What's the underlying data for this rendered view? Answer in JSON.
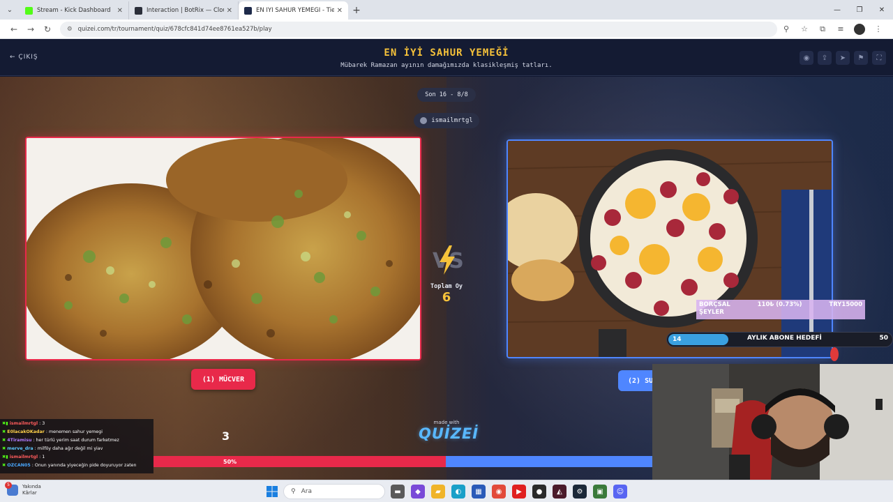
{
  "browser": {
    "tabs": [
      {
        "title": "Stream - Kick Dashboard",
        "color": "#53fc18"
      },
      {
        "title": "Interaction | BotRix — Cloud Str",
        "color": "#2b2f3a"
      },
      {
        "title": "EN İYİ SAHUR YEMEĞİ - Tier Li",
        "color": "#1e2a4a"
      }
    ],
    "url": "quizei.com/tr/tournament/quiz/678cfc841d74ee8761ea527b/play"
  },
  "app": {
    "exit_label": "ÇIKIŞ",
    "title": "EN İYİ SAHUR YEMEĞİ",
    "subtitle": "Mübarek Ramazan ayının damağımızda klasikleşmiş tatları.",
    "round": "Son 16 - 8/8",
    "username": "ismailmrtgl",
    "total_votes_label": "Toplam Oy",
    "total_votes": "6",
    "left_choice": {
      "key": "(1)",
      "name": "MÜCVER",
      "score": "3"
    },
    "right_choice": {
      "key": "(2)",
      "name": "SU"
    },
    "made_with": "made with",
    "brand": "QUİZEİ",
    "left_percent": "50%",
    "left_share": 0.5,
    "accent_red": "#e8294a",
    "accent_blue": "#4f86ff",
    "title_color": "#f6c23a"
  },
  "chat": [
    {
      "nick": "ismailmrtgl",
      "msg": "3",
      "color": "#ff5c5c"
    },
    {
      "nick": "E0lacakOKadar",
      "msg": "menemen sahur yemegi",
      "color": "#ffd24a"
    },
    {
      "nick": "4Tiramisu",
      "msg": "her türlü yerim saat durum farketmez",
      "color": "#b07cff"
    },
    {
      "nick": "merve_dra",
      "msg": "milföy daha ağır değil mi yiav",
      "color": "#5ec8ff"
    },
    {
      "nick": "ismailmrtgl",
      "msg": "1",
      "color": "#ff5c5c"
    },
    {
      "nick": "OZCAN05",
      "msg": "Onun yanında yiyeceğin pide doyuruyor zaten",
      "color": "#4aa8ff"
    }
  ],
  "goal": {
    "name_line1": "BORÇSAL",
    "name_line2": "ŞEYLER",
    "amount": "110₺ (0.73%)",
    "target": "TRY15000",
    "current": "14",
    "label": "AYLIK ABONE HEDEFİ",
    "max": "50"
  },
  "taskbar": {
    "weather_line1": "Yakında",
    "weather_line2": "Kârlar",
    "notif_count": "5",
    "search_placeholder": "Ara"
  }
}
